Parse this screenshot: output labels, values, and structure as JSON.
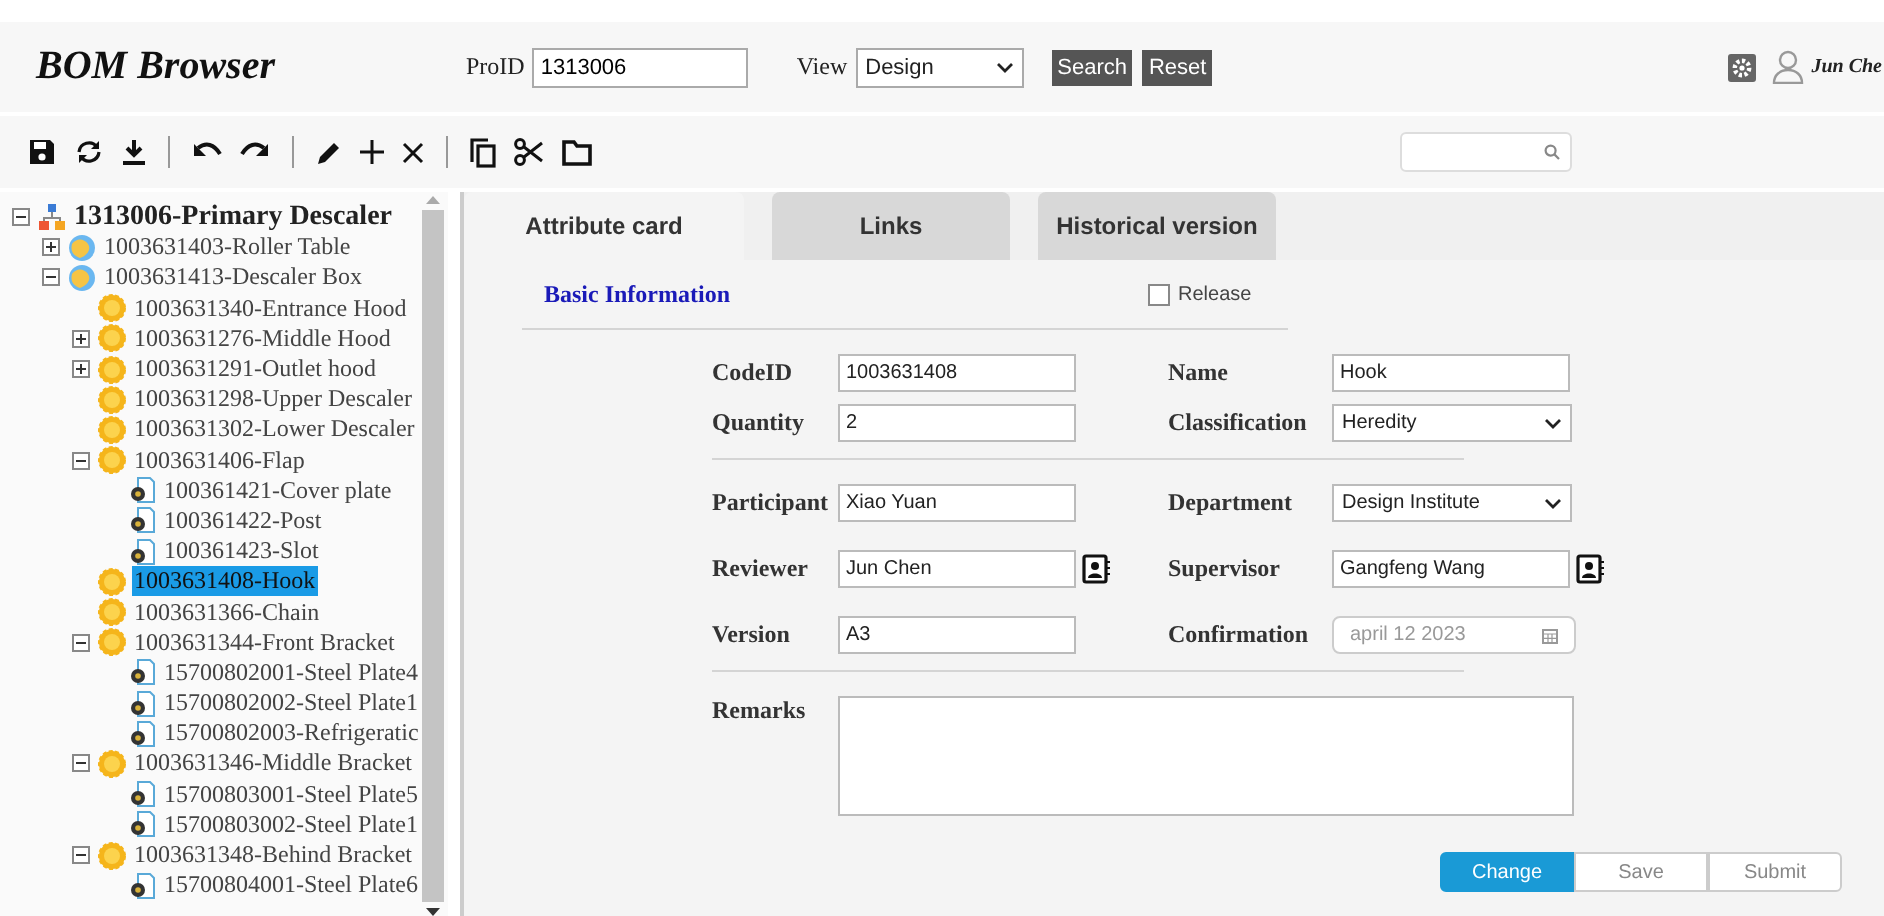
{
  "header": {
    "title": "BOM Browser",
    "proid": {
      "label": "ProID",
      "value": "1313006"
    },
    "view": {
      "label": "View",
      "value": "Design"
    },
    "buttons": [
      "Search",
      "Reset"
    ],
    "user": "Jun Che"
  },
  "tree": [
    {
      "label": "1313006-Primary Descaler",
      "kind": "root",
      "expanded": true,
      "children": [
        {
          "label": "1003631403-Roller Table",
          "kind": "assembly",
          "expanded": false
        },
        {
          "label": "1003631413-Descaler Box",
          "kind": "assembly",
          "expanded": true,
          "children": [
            {
              "label": "1003631340-Entrance Hood",
              "kind": "part"
            },
            {
              "label": "1003631276-Middle Hood",
              "kind": "part",
              "expanded": false
            },
            {
              "label": "1003631291-Outlet hood",
              "kind": "part",
              "expanded": false
            },
            {
              "label": "1003631298-Upper Descaler",
              "kind": "part"
            },
            {
              "label": "1003631302-Lower Descaler",
              "kind": "part"
            },
            {
              "label": "1003631406-Flap",
              "kind": "part",
              "expanded": true,
              "children": [
                {
                  "label": "100361421-Cover plate",
                  "kind": "file"
                },
                {
                  "label": "100361422-Post",
                  "kind": "file"
                },
                {
                  "label": "100361423-Slot",
                  "kind": "file"
                }
              ]
            },
            {
              "label": "1003631408-Hook",
              "kind": "part",
              "selected": true
            },
            {
              "label": "1003631366-Chain",
              "kind": "part"
            },
            {
              "label": "1003631344-Front Bracket",
              "kind": "part",
              "expanded": true,
              "children": [
                {
                  "label": "15700802001-Steel Plate4",
                  "kind": "file"
                },
                {
                  "label": "15700802002-Steel Plate1",
                  "kind": "file"
                },
                {
                  "label": "15700802003-Refrigeratic",
                  "kind": "file"
                }
              ]
            },
            {
              "label": "1003631346-Middle Bracket",
              "kind": "part",
              "expanded": true,
              "children": [
                {
                  "label": "15700803001-Steel Plate5",
                  "kind": "file"
                },
                {
                  "label": "15700803002-Steel Plate1",
                  "kind": "file"
                }
              ]
            },
            {
              "label": "1003631348-Behind Bracket",
              "kind": "part",
              "expanded": true,
              "children": [
                {
                  "label": "15700804001-Steel Plate6",
                  "kind": "file"
                }
              ]
            }
          ]
        }
      ]
    }
  ],
  "tabs": [
    {
      "label": "Attribute card",
      "selected": true
    },
    {
      "label": "Links",
      "selected": false
    },
    {
      "label": "Historical version",
      "selected": false
    }
  ],
  "form": {
    "section_title": "Basic Information",
    "release": {
      "label": "Release",
      "checked": false
    },
    "groups": [
      [
        {
          "label": "CodeID",
          "value": "1003631408",
          "kind": "text"
        },
        {
          "label": "Name",
          "value": "Hook",
          "kind": "text"
        },
        {
          "label": "Quantity",
          "value": "2",
          "kind": "text"
        },
        {
          "label": "Classification",
          "value": "Heredity",
          "kind": "select"
        }
      ],
      [
        {
          "label": "Participant",
          "value": "Xiao Yuan",
          "kind": "text"
        },
        {
          "label": "Department",
          "value": "Design Institute",
          "kind": "select"
        },
        {
          "label": "Reviewer",
          "value": "Jun Chen",
          "kind": "person"
        },
        {
          "label": "Supervisor",
          "value": "Gangfeng Wang",
          "kind": "person"
        },
        {
          "label": "Version",
          "value": "A3",
          "kind": "text"
        },
        {
          "label": "Confirmation",
          "placeholder": "april 12 2023",
          "kind": "date"
        }
      ]
    ],
    "remarks": {
      "label": "Remarks"
    },
    "buttons": [
      {
        "label": "Change",
        "selected": true
      },
      {
        "label": "Save",
        "selected": false
      },
      {
        "label": "Submit",
        "selected": false
      }
    ]
  }
}
